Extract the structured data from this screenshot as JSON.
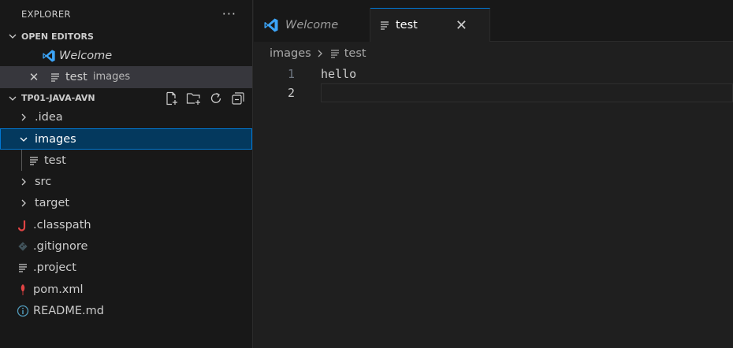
{
  "explorer": {
    "title": "EXPLORER",
    "more_label": "···"
  },
  "open_editors": {
    "title": "OPEN EDITORS",
    "items": [
      {
        "label": "Welcome",
        "icon": "vscode-logo-icon"
      },
      {
        "label": "test",
        "description": "images",
        "icon": "text-file-icon",
        "close_label": "✕"
      }
    ]
  },
  "project": {
    "title": "TP01-JAVA-AVN",
    "actions": [
      "new-file-icon",
      "new-folder-icon",
      "refresh-icon",
      "collapse-all-icon"
    ],
    "tree": [
      {
        "label": ".idea",
        "type": "folder",
        "expanded": false
      },
      {
        "label": "images",
        "type": "folder",
        "expanded": true
      },
      {
        "label": "test",
        "type": "file",
        "icon": "text-file-icon"
      },
      {
        "label": "src",
        "type": "folder",
        "expanded": false
      },
      {
        "label": "target",
        "type": "folder",
        "expanded": false
      },
      {
        "label": ".classpath",
        "type": "file",
        "icon": "java-icon"
      },
      {
        "label": ".gitignore",
        "type": "file",
        "icon": "git-icon"
      },
      {
        "label": ".project",
        "type": "file",
        "icon": "text-file-icon"
      },
      {
        "label": "pom.xml",
        "type": "file",
        "icon": "maven-icon"
      },
      {
        "label": "README.md",
        "type": "file",
        "icon": "info-icon"
      }
    ]
  },
  "tabs": [
    {
      "label": "Welcome",
      "icon": "vscode-logo-icon",
      "active": false
    },
    {
      "label": "test",
      "icon": "text-file-icon",
      "active": true,
      "close_label": "✕"
    }
  ],
  "breadcrumbs": {
    "folder": "images",
    "file": "test"
  },
  "editor": {
    "lines": [
      {
        "number": "1",
        "text": "hello"
      },
      {
        "number": "2",
        "text": ""
      }
    ]
  },
  "colors": {
    "accent": "#0078d4",
    "vscode_blue": "#3ca4f7",
    "java_red": "#e04444",
    "selection": "#04395e"
  }
}
